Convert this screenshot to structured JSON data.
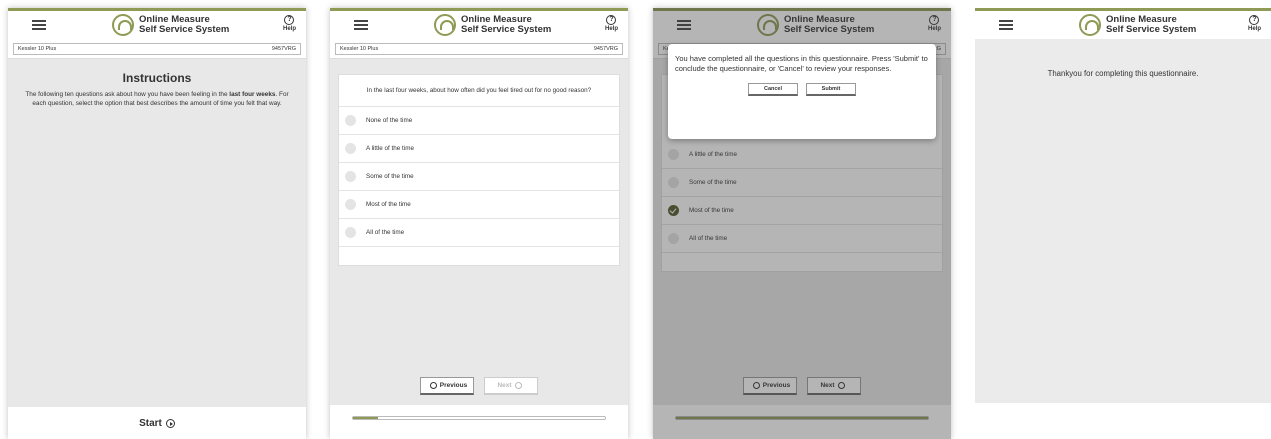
{
  "app": {
    "logo_line1": "Online Measure",
    "logo_line2": "Self Service System",
    "help_label": "Help",
    "help_glyph": "?"
  },
  "info": {
    "measure": "Kessler 10 Plus",
    "code": "9457VRG"
  },
  "screen1": {
    "heading": "Instructions",
    "text_before": "The following ten questions ask about how you have been feeling in the ",
    "text_bold": "last four weeks",
    "text_after": ". For each question, select the option that best describes the amount of time you felt that way.",
    "start_label": "Start"
  },
  "screen2": {
    "question": "In the last four weeks, about how often did you feel tired out for no good reason?",
    "options": [
      "None of the time",
      "A little of the time",
      "Some of the time",
      "Most of the time",
      "All of the time"
    ],
    "selected_index": -1,
    "previous_label": "Previous",
    "next_label": "Next",
    "progress_fraction": 0.1
  },
  "screen3": {
    "modal_text": "You have completed all the questions in this questionnaire. Press 'Submit' to conclude the questionnaire, or 'Cancel' to review your responses.",
    "cancel_label": "Cancel",
    "submit_label": "Submit",
    "options": [
      "A little of the time",
      "Some of the time",
      "Most of the time",
      "All of the time"
    ],
    "selected_index": 2,
    "previous_label": "Previous",
    "next_label": "Next",
    "progress_fraction": 1.0
  },
  "screen4": {
    "message": "Thankyou for completing this questionnaire."
  },
  "colors": {
    "accent": "#8f9a54",
    "selected": "#525a2a"
  }
}
